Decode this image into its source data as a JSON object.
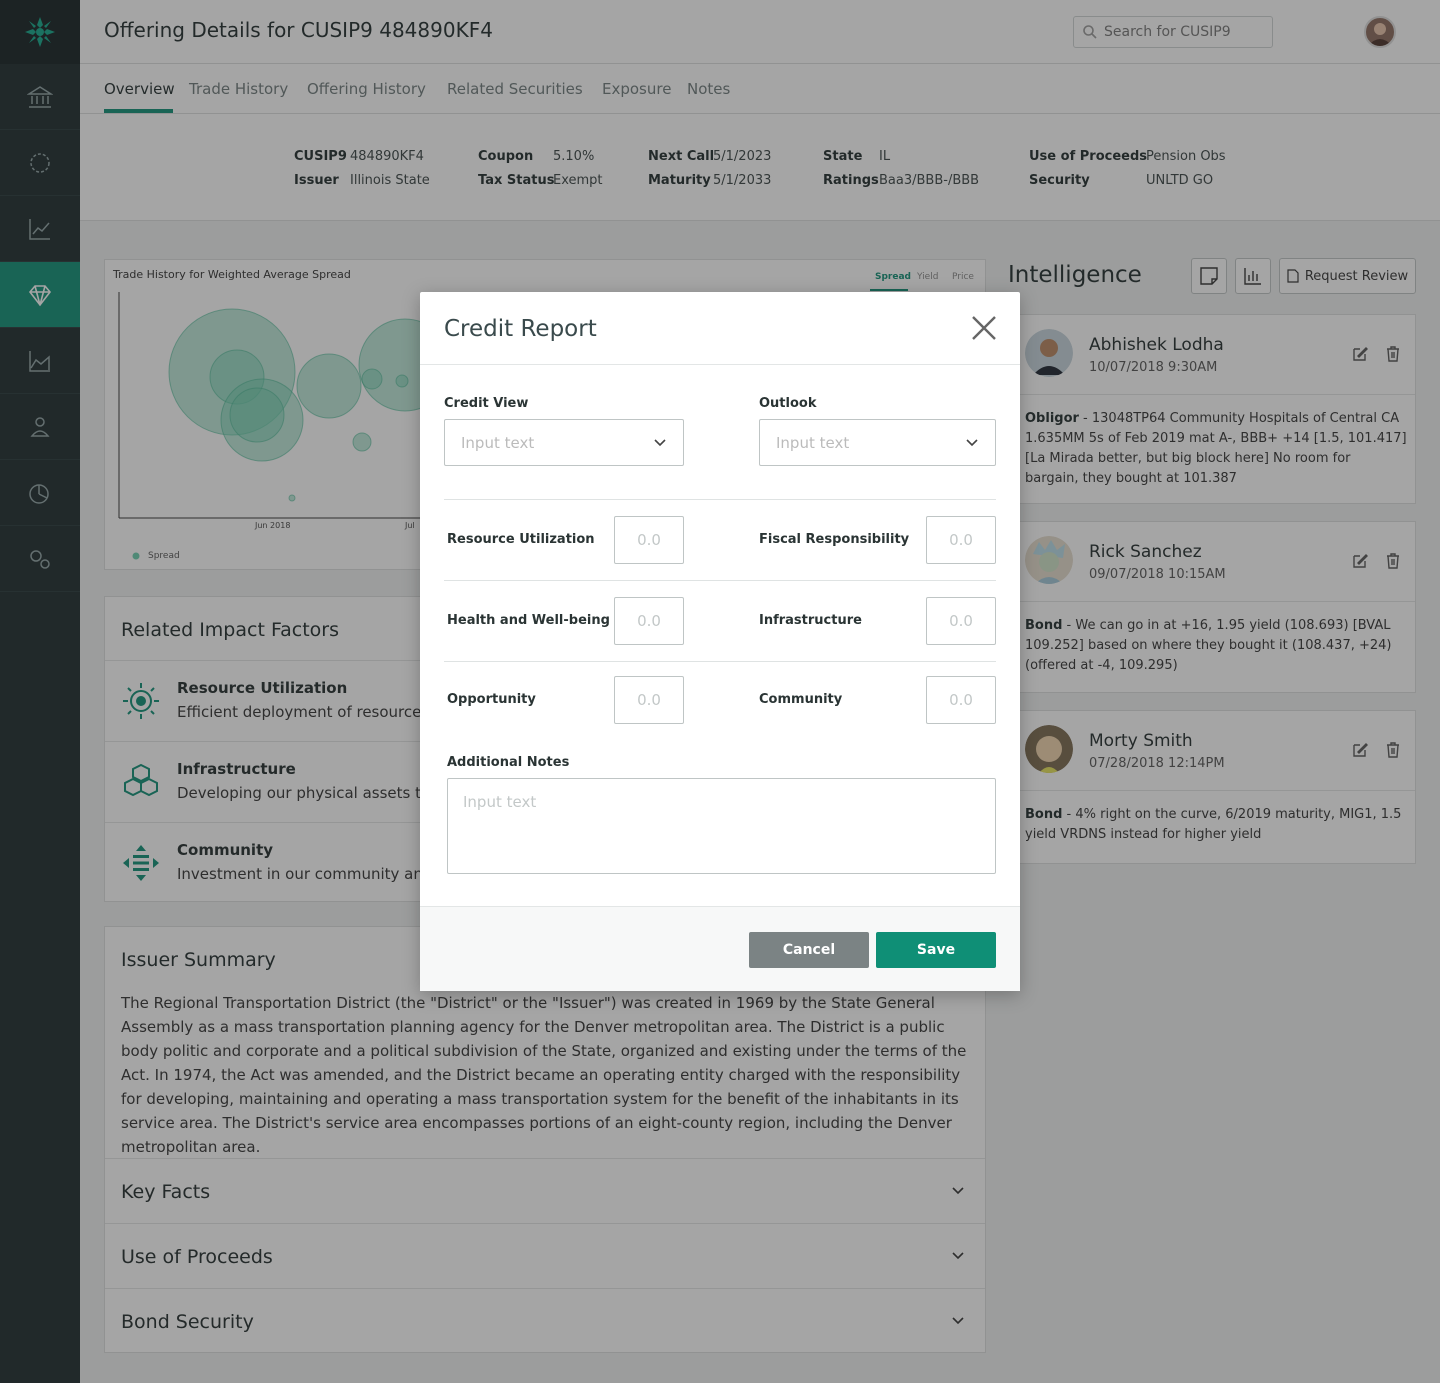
{
  "header": {
    "title": "Offering Details for CUSIP9 484890KF4",
    "search_placeholder": "Search for CUSIP9"
  },
  "tabs": [
    {
      "label": "Overview",
      "active": true
    },
    {
      "label": "Trade History"
    },
    {
      "label": "Offering History"
    },
    {
      "label": "Related Securities"
    },
    {
      "label": "Exposure"
    },
    {
      "label": "Notes"
    }
  ],
  "summary": {
    "cusip_label": "CUSIP9",
    "cusip": "484890KF4",
    "issuer_label": "Issuer",
    "issuer": "Illinois State",
    "coupon_label": "Coupon",
    "coupon": "5.10%",
    "tax_label": "Tax Status",
    "tax": "Exempt",
    "next_call_label": "Next Call",
    "next_call": "5/1/2023",
    "maturity_label": "Maturity",
    "maturity": "5/1/2033",
    "state_label": "State",
    "state": "IL",
    "ratings_label": "Ratings",
    "ratings": "Baa3/BBB-/BBB",
    "proceeds_label": "Use of Proceeds",
    "proceeds": "Pension Obs",
    "security_label": "Security",
    "security": "UNLTD GO"
  },
  "chart": {
    "title": "Trade History for Weighted Average Spread",
    "tabs": [
      "Spread",
      "Yield",
      "Price"
    ],
    "x_ticks": [
      "Jun 2018",
      "Jul"
    ],
    "legend": "Spread"
  },
  "impact": {
    "title": "Related Impact Factors",
    "items": [
      {
        "name": "Resource Utilization",
        "desc": "Efficient deployment of resources"
      },
      {
        "name": "Infrastructure",
        "desc": "Developing our physical assets to"
      },
      {
        "name": "Community",
        "desc": "Investment in our community and"
      }
    ]
  },
  "issuer": {
    "title": "Issuer Summary",
    "text": "The Regional Transportation District (the \"District\" or the \"Issuer\") was created in 1969 by the State General Assembly as a mass transportation planning agency for the Denver metropolitan area. The District is a public body politic and corporate and a political subdivision of the State, organized and existing under the terms of the Act. In 1974, the Act was amended, and the District became an operating entity charged with the responsibility for developing, maintaining and operating a mass transportation system for the benefit of the inhabitants in its service area. The District's service area encompasses portions of an eight-county region, including the Denver metropolitan area.",
    "sections": [
      "Key Facts",
      "Use of Proceeds",
      "Bond Security"
    ]
  },
  "intelligence": {
    "title": "Intelligence",
    "request_label": "Request Review",
    "notes": [
      {
        "name": "Abhishek Lodha",
        "date": "10/07/2018 9:30AM",
        "tag": "Obligor",
        "text": " - 13048TP64 Community Hospitals of Central CA 1.635MM 5s of Feb 2019 mat A-, BBB+ +14 [1.5, 101.417] [La Mirada better, but big block here] No room for bargain, they bought at 101.387"
      },
      {
        "name": "Rick Sanchez",
        "date": "09/07/2018 10:15AM",
        "tag": "Bond",
        "text": " - We can go in at +16, 1.95 yield (108.693) [BVAL 109.252] based on where they bought it (108.437, +24) (offered at -4, 109.295)"
      },
      {
        "name": "Morty Smith",
        "date": "07/28/2018 12:14PM",
        "tag": "Bond",
        "text": " - 4% right on the curve, 6/2019 maturity, MIG1, 1.5 yield VRDNS instead for higher yield"
      }
    ]
  },
  "modal": {
    "title": "Credit Report",
    "credit_view_label": "Credit View",
    "credit_view_placeholder": "Input text",
    "outlook_label": "Outlook",
    "outlook_placeholder": "Input text",
    "fields": {
      "resource": "Resource Utilization",
      "fiscal": "Fiscal Responsibility",
      "health": "Health and Well-being",
      "infra": "Infrastructure",
      "opportunity": "Opportunity",
      "community": "Community"
    },
    "num_placeholder": "0.0",
    "notes_label": "Additional Notes",
    "notes_placeholder": "Input text",
    "cancel": "Cancel",
    "save": "Save"
  },
  "colors": {
    "accent": "#0f8f76",
    "sidebar": "#1d2a2c"
  }
}
